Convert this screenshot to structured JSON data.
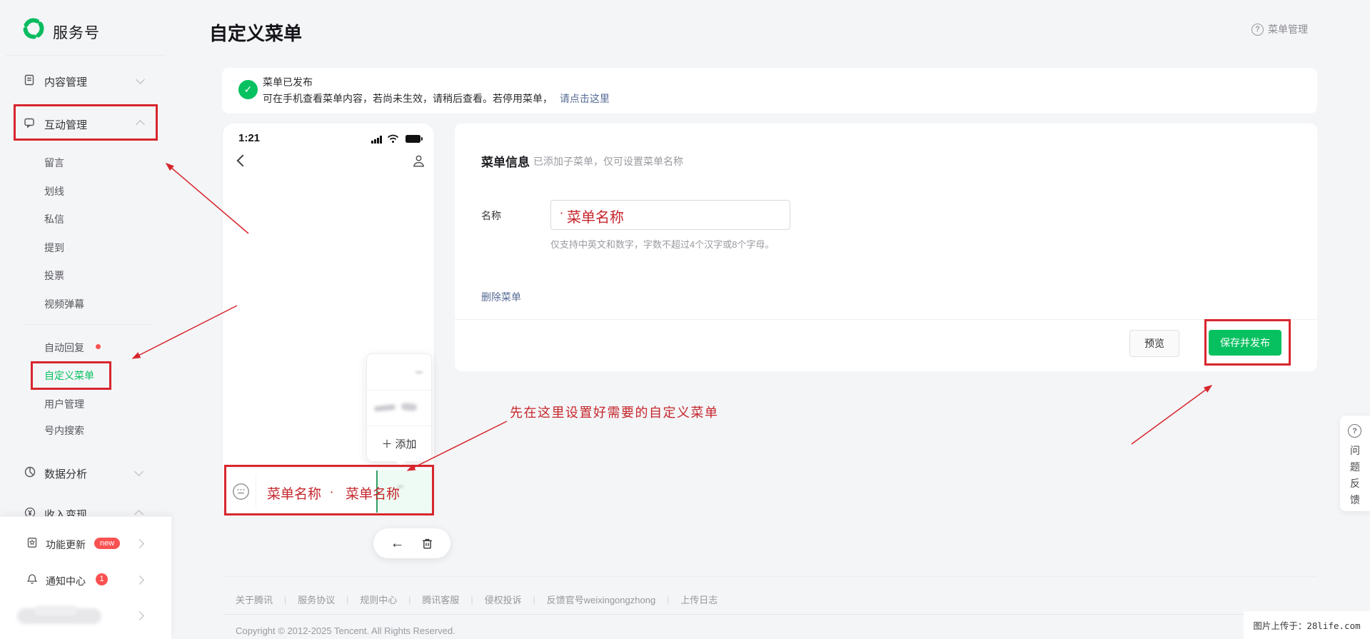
{
  "brand": {
    "name": "服务号"
  },
  "header": {
    "title": "自定义菜单",
    "menu_mgmt": "菜单管理"
  },
  "sidebar": {
    "groups": {
      "content": "内容管理",
      "interact": "互动管理",
      "data": "数据分析",
      "revenue": "收入变现"
    },
    "sub_items": [
      "留言",
      "划线",
      "私信",
      "提到",
      "投票",
      "视频弹幕"
    ],
    "tools": {
      "auto_reply": "自动回复",
      "custom_menu": "自定义菜单",
      "user_mgmt": "用户管理",
      "account_search": "号内搜索"
    },
    "bottom": {
      "feature_update": "功能更新",
      "feature_badge": "new",
      "notify_center": "通知中心",
      "notify_badge": "1"
    }
  },
  "banner": {
    "title": "菜单已发布",
    "body": "可在手机查看菜单内容，若尚未生效，请稍后查看。若停用菜单，",
    "link": "请点击这里"
  },
  "phone": {
    "time": "1:21",
    "popup_add": "添加",
    "menu_name_1": "菜单名称",
    "menu_name_2": "菜单名称"
  },
  "form": {
    "section_title": "菜单信息",
    "section_hint": "已添加子菜单，仅可设置菜单名称",
    "name_label": "名称",
    "name_value": "菜单名称",
    "helper": "仅支持中英文和数字，字数不超过4个汉字或8个字母。",
    "delete_link": "删除菜单",
    "preview_button": "预览",
    "save_button": "保存并发布"
  },
  "annotations": {
    "tip": "先在这里设置好需要的自定义菜单"
  },
  "footer": {
    "links": [
      "关于腾讯",
      "服务协议",
      "规则中心",
      "腾讯客服",
      "侵权投诉",
      "反馈官号weixingongzhong",
      "上传日志"
    ],
    "separator": "|",
    "copyright": "Copyright © 2012-2025 Tencent. All Rights Reserved."
  },
  "feedback": {
    "label": "问题反馈"
  },
  "watermark": {
    "text": "图片上传于：28life.com"
  },
  "icons": {
    "help": "?",
    "check": "✓",
    "plus": "＋",
    "left_arrow": "←",
    "middot": "·"
  },
  "colors": {
    "brand_green": "#07c160",
    "annotation_red": "#d7262d",
    "badge_red": "#fa5151",
    "link_blue": "#576b95"
  }
}
